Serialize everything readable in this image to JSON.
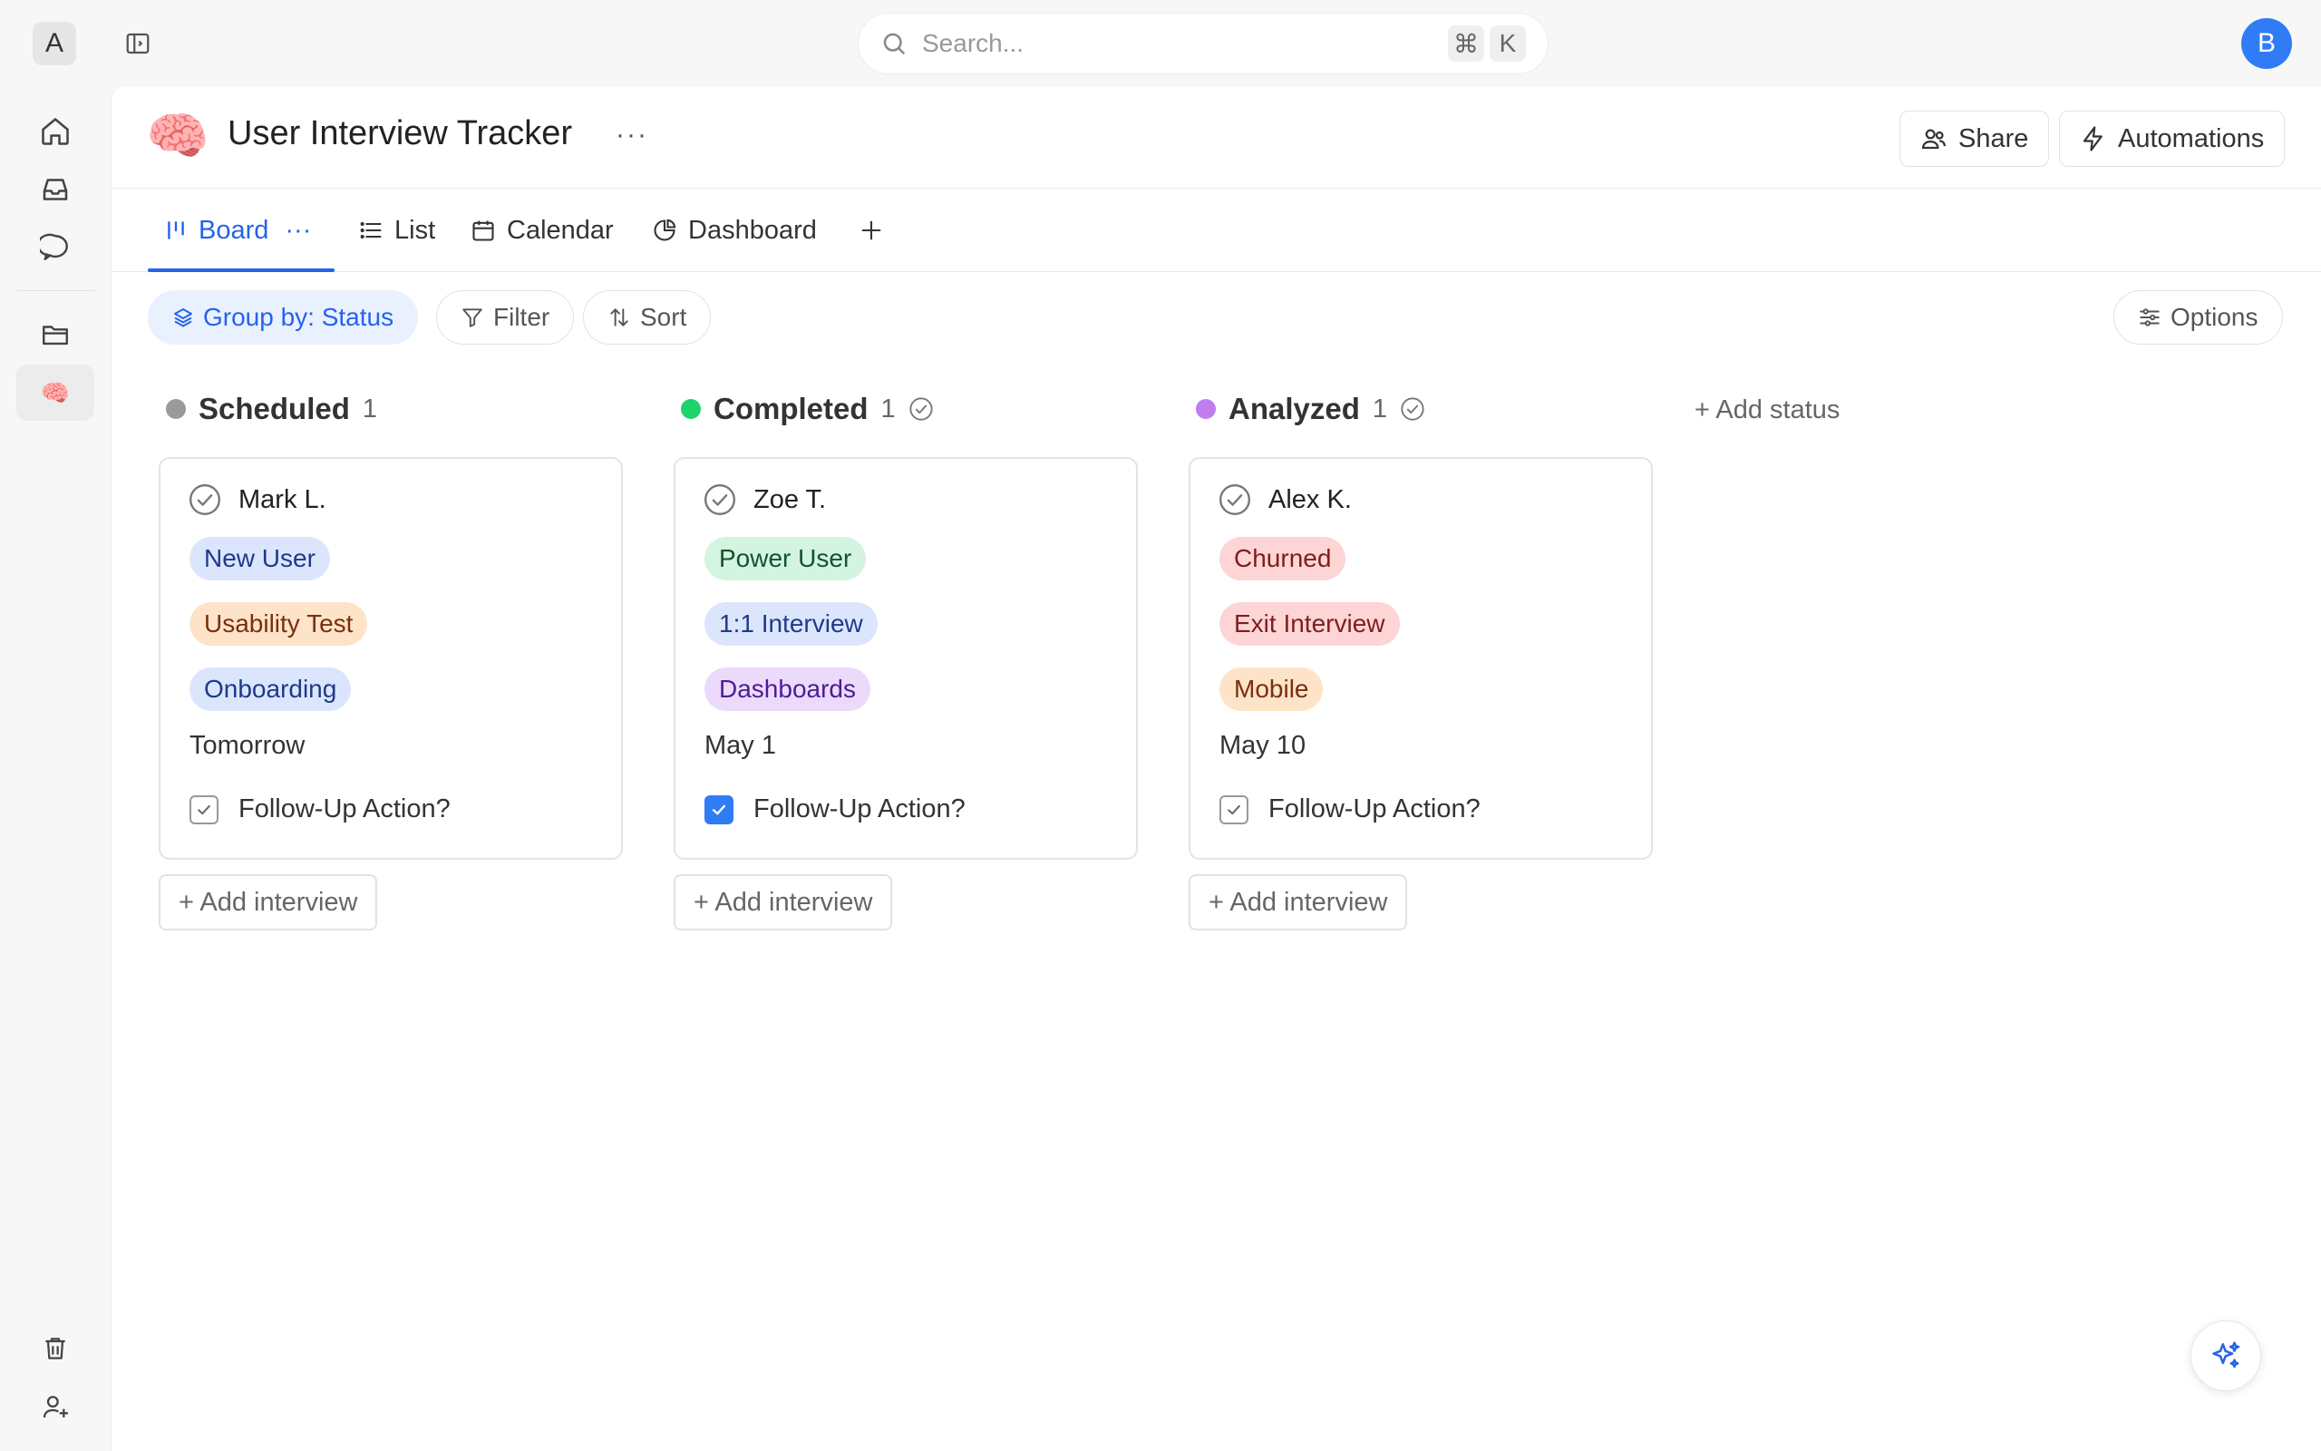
{
  "workspace": {
    "avatar_letter": "A"
  },
  "user": {
    "avatar_letter": "B"
  },
  "search": {
    "placeholder": "Search...",
    "shortcut_cmd": "⌘",
    "shortcut_key": "K"
  },
  "sidebar": {
    "items": [
      {
        "icon": "home-icon"
      },
      {
        "icon": "inbox-icon"
      },
      {
        "icon": "chat-icon"
      },
      {
        "icon": "folder-icon"
      },
      {
        "icon": "brain-emoji",
        "emoji": "🧠",
        "active": true
      }
    ],
    "bottom": [
      {
        "icon": "trash-icon"
      },
      {
        "icon": "add-user-icon"
      }
    ]
  },
  "page": {
    "emoji": "🧠",
    "title": "User Interview Tracker",
    "more": "···",
    "share_label": "Share",
    "automations_label": "Automations"
  },
  "tabs": [
    {
      "label": "Board",
      "more": "···",
      "active": true
    },
    {
      "label": "List"
    },
    {
      "label": "Calendar"
    },
    {
      "label": "Dashboard"
    }
  ],
  "toolbar": {
    "group_by": "Group by: Status",
    "filter": "Filter",
    "sort": "Sort",
    "options": "Options"
  },
  "board": {
    "add_status": "+ Add status",
    "add_card_label": "+ Add interview",
    "columns": [
      {
        "name": "Scheduled",
        "count": "1",
        "color": "#9a9a9a",
        "cards": [
          {
            "name": "Mark L.",
            "tags": [
              {
                "text": "New User",
                "bg": "#dbe6fd",
                "fg": "#1e3a8a"
              },
              {
                "text": "Usability Test",
                "bg": "#fde4c8",
                "fg": "#7c2d12"
              },
              {
                "text": "Onboarding",
                "bg": "#dbe6fd",
                "fg": "#1e3a8a"
              }
            ],
            "date": "Tomorrow",
            "follow_up_label": "Follow-Up Action?",
            "follow_up_checked": false
          }
        ]
      },
      {
        "name": "Completed",
        "count": "1",
        "color": "#1fd36c",
        "cards": [
          {
            "name": "Zoe T.",
            "tags": [
              {
                "text": "Power User",
                "bg": "#d3f4e1",
                "fg": "#14532d"
              },
              {
                "text": "1:1 Interview",
                "bg": "#dbe6fd",
                "fg": "#1e3a8a"
              },
              {
                "text": "Dashboards",
                "bg": "#ecdafb",
                "fg": "#4c1d95"
              }
            ],
            "date": "May 1",
            "follow_up_label": "Follow-Up Action?",
            "follow_up_checked": true
          }
        ]
      },
      {
        "name": "Analyzed",
        "count": "1",
        "color": "#c07df0",
        "cards": [
          {
            "name": "Alex K.",
            "tags": [
              {
                "text": "Churned",
                "bg": "#fdd5d5",
                "fg": "#7f1d1d"
              },
              {
                "text": "Exit Interview",
                "bg": "#fdd5d5",
                "fg": "#7f1d1d"
              },
              {
                "text": "Mobile",
                "bg": "#fde4c8",
                "fg": "#7c2d12"
              }
            ],
            "date": "May 10",
            "follow_up_label": "Follow-Up Action?",
            "follow_up_checked": false
          }
        ]
      }
    ]
  },
  "colors": {
    "accent": "#2563eb",
    "avatar": "#2f7cf6"
  }
}
